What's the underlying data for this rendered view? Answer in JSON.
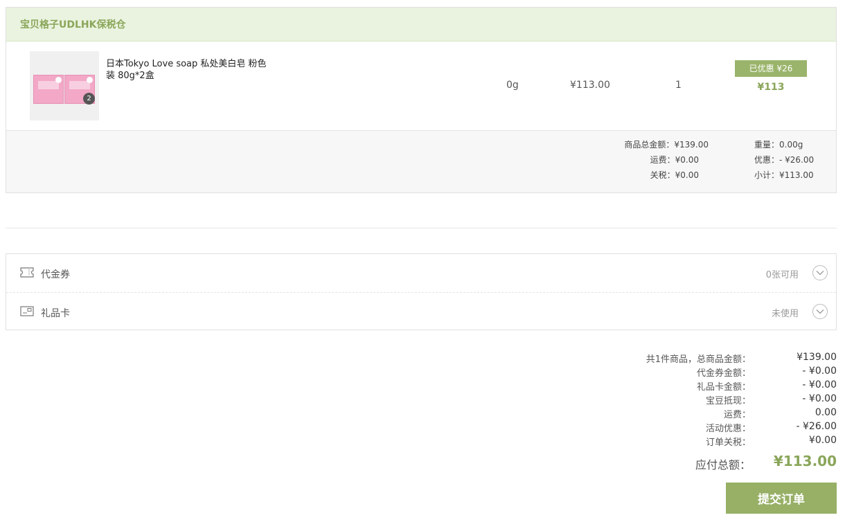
{
  "store": {
    "name": "宝贝格子UDLHK保税仓"
  },
  "item": {
    "name": "日本Tokyo Love soap 私处美白皂 粉色装 80g*2盒",
    "image_badge": "2",
    "weight": "0g",
    "price": "¥113.00",
    "quantity": "1",
    "discount_tag": "已优惠 ¥26",
    "total": "¥113"
  },
  "store_summary": {
    "goods_total_label": "商品总金额：",
    "goods_total_value": "¥139.00",
    "shipping_label": "运费：",
    "shipping_value": "¥0.00",
    "tax_label": "关税：",
    "tax_value": "¥0.00",
    "weight_label": "重量：",
    "weight_value": "0.00g",
    "discount_label": "优惠：",
    "discount_value": "- ¥26.00",
    "subtotal_label": "小计：",
    "subtotal_value": "¥113.00"
  },
  "options": [
    {
      "label": "代金券",
      "status": "0张可用",
      "icon": "ticket-icon"
    },
    {
      "label": "礼品卡",
      "status": "未使用",
      "icon": "gift-card-icon"
    }
  ],
  "totals": [
    {
      "label": "共1件商品，总商品金额：",
      "value": "¥139.00"
    },
    {
      "label": "代金券金额：",
      "value": "- ¥0.00"
    },
    {
      "label": "礼品卡金额：",
      "value": "- ¥0.00"
    },
    {
      "label": "宝豆抵现：",
      "value": "- ¥0.00"
    },
    {
      "label": "运费：",
      "value": "0.00"
    },
    {
      "label": "活动优惠：",
      "value": "- ¥26.00"
    },
    {
      "label": "订单关税：",
      "value": "¥0.00"
    }
  ],
  "grand_total": {
    "label": "应付总额：",
    "value": "¥113.00"
  },
  "submit_label": "提交订单",
  "colors": {
    "accent": "#97b066",
    "header_bg": "#eaf3df"
  }
}
